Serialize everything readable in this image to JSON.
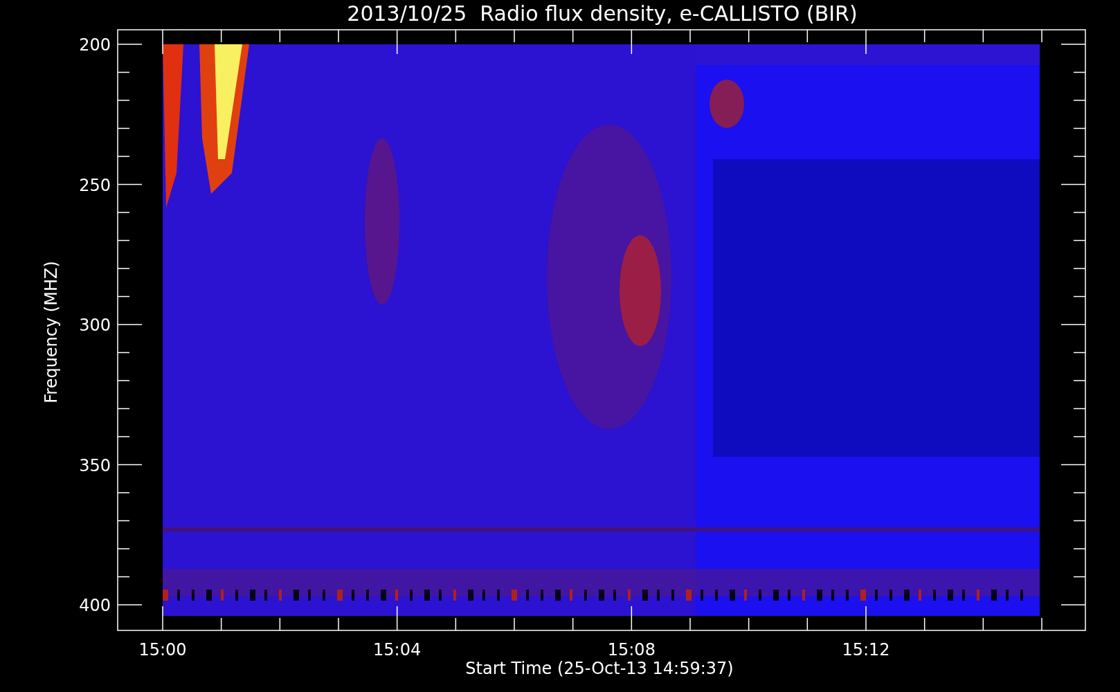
{
  "title": "2013/10/25  Radio flux density, e-CALLISTO (BIR)",
  "y_axis": {
    "label": "Frequency (MHZ)",
    "ticks": [
      "200",
      "250",
      "300",
      "350",
      "400"
    ]
  },
  "x_axis": {
    "label": "Start Time (25-Oct-13 14:59:37)",
    "ticks": [
      "15:00",
      "15:04",
      "15:08",
      "15:12"
    ]
  }
}
